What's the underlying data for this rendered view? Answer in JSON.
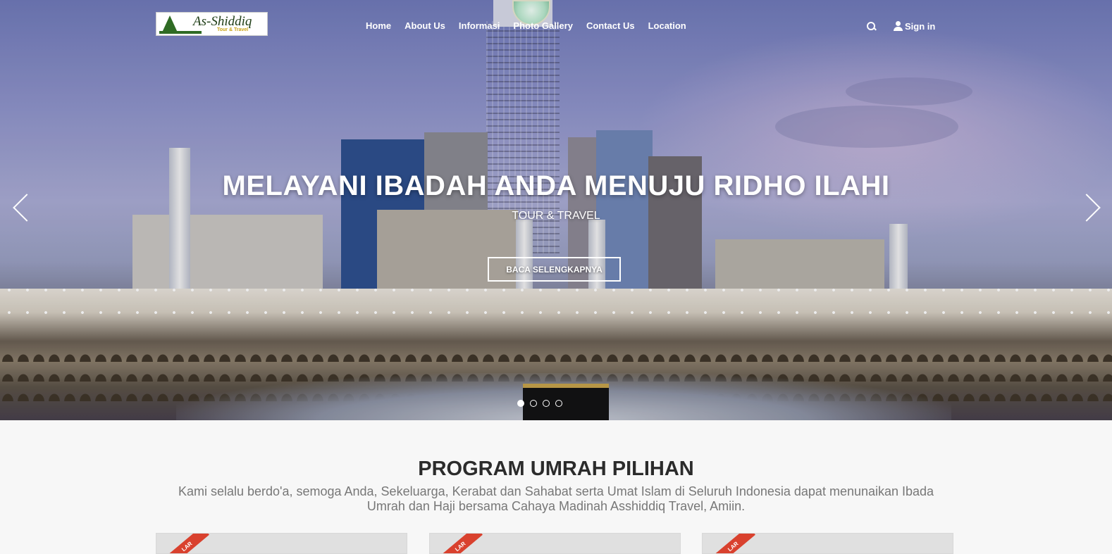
{
  "brand": {
    "name": "As-Shiddiq",
    "tagline": "Tour & Travel"
  },
  "nav": {
    "items": [
      {
        "label": "Home"
      },
      {
        "label": "About Us"
      },
      {
        "label": "Informasi"
      },
      {
        "label": "Photo Gallery"
      },
      {
        "label": "Contact Us"
      },
      {
        "label": "Location"
      }
    ],
    "search_icon": "search-icon",
    "signin_label": "Sign in"
  },
  "hero": {
    "title": "MELAYANI IBADAH ANDA MENUJU RIDHO ILAHI",
    "subtitle": "TOUR & TRAVEL",
    "button_label": "BACA SELENGKAPNYA",
    "slide_count": 4,
    "active_slide": 1
  },
  "section": {
    "title": "PROGRAM UMRAH PILIHAN",
    "description": "Kami selalu berdo'a, semoga Anda, Sekeluarga, Kerabat dan Sahabat serta Umat Islam di Seluruh Indonesia dapat menunaikan Ibada Umrah dan Haji bersama Cahaya Madinah Asshiddiq Travel, Amiin."
  },
  "cards": [
    {
      "ribbon": "LAR"
    },
    {
      "ribbon": "LAR"
    },
    {
      "ribbon": "LAR"
    }
  ],
  "colors": {
    "ribbon": "#d9412e",
    "logo_green": "#2f6b24",
    "logo_gold": "#c8a215"
  }
}
